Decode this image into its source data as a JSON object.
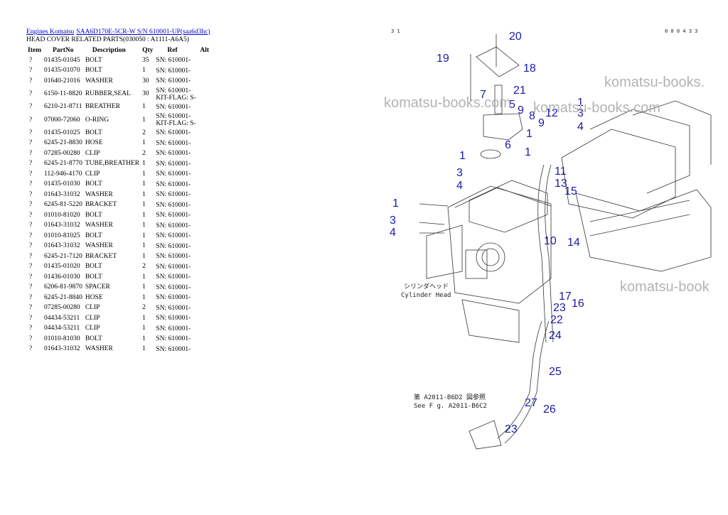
{
  "breadcrumb": [
    {
      "label": "Engines Komatsu"
    },
    {
      "label": "SAA6D170E-5CR-W S/N 610001-UP(saa6d3hc)"
    }
  ],
  "page_title": "HEAD COVER RELATED PARTS(030050 : A1111-A6A5)",
  "table": {
    "headers": [
      "Item",
      "PartNo",
      "Description",
      "Qty",
      "Ref",
      "Alt"
    ],
    "rows": [
      {
        "item": "?",
        "partno": "01435-01045",
        "desc": "BOLT",
        "qty": "35",
        "ref": "SN: 610001-"
      },
      {
        "item": "?",
        "partno": "01435-01070",
        "desc": "BOLT",
        "qty": "1",
        "ref": "SN: 610001-"
      },
      {
        "item": "?",
        "partno": "01640-21016",
        "desc": "WASHER",
        "qty": "30",
        "ref": "SN: 610001-"
      },
      {
        "item": "?",
        "partno": "6150-11-8820",
        "desc": "RUBBER,SEAL",
        "qty": "30",
        "ref": "SN: 610001- KIT-FLAG: S-"
      },
      {
        "item": "?",
        "partno": "6210-21-8711",
        "desc": "BREATHER",
        "qty": "1",
        "ref": "SN: 610001-"
      },
      {
        "item": "?",
        "partno": "07000-72060",
        "desc": "O-RING",
        "qty": "1",
        "ref": "SN: 610001- KIT-FLAG: S-"
      },
      {
        "item": "?",
        "partno": "01435-01025",
        "desc": "BOLT",
        "qty": "2",
        "ref": "SN: 610001-"
      },
      {
        "item": "?",
        "partno": "6245-21-8830",
        "desc": "HOSE",
        "qty": "1",
        "ref": "SN: 610001-"
      },
      {
        "item": "?",
        "partno": "07285-00280",
        "desc": "CLIP",
        "qty": "2",
        "ref": "SN: 610001-"
      },
      {
        "item": "?",
        "partno": "6245-21-8770",
        "desc": "TUBE,BREATHER",
        "qty": "1",
        "ref": "SN: 610001-"
      },
      {
        "item": "?",
        "partno": "112-946-4170",
        "desc": "CLIP",
        "qty": "1",
        "ref": "SN: 610001-"
      },
      {
        "item": "?",
        "partno": "01435-01030",
        "desc": "BOLT",
        "qty": "1",
        "ref": "SN: 610001-"
      },
      {
        "item": "?",
        "partno": "01643-31032",
        "desc": "WASHER",
        "qty": "1",
        "ref": "SN: 610001-"
      },
      {
        "item": "?",
        "partno": "6245-81-5220",
        "desc": "BRACKET",
        "qty": "1",
        "ref": "SN: 610001-"
      },
      {
        "item": "?",
        "partno": "01010-81020",
        "desc": "BOLT",
        "qty": "1",
        "ref": "SN: 610001-"
      },
      {
        "item": "?",
        "partno": "01643-31032",
        "desc": "WASHER",
        "qty": "1",
        "ref": "SN: 610001-"
      },
      {
        "item": "?",
        "partno": "01010-81025",
        "desc": "BOLT",
        "qty": "1",
        "ref": "SN: 610001-"
      },
      {
        "item": "?",
        "partno": "01643-31032",
        "desc": "WASHER",
        "qty": "1",
        "ref": "SN: 610001-"
      },
      {
        "item": "?",
        "partno": "6245-21-7120",
        "desc": "BRACKET",
        "qty": "1",
        "ref": "SN: 610001-"
      },
      {
        "item": "?",
        "partno": "01435-01020",
        "desc": "BOLT",
        "qty": "2",
        "ref": "SN: 610001-"
      },
      {
        "item": "?",
        "partno": "01436-01030",
        "desc": "BOLT",
        "qty": "1",
        "ref": "SN: 610001-"
      },
      {
        "item": "?",
        "partno": "6206-81-9870",
        "desc": "SPACER",
        "qty": "1",
        "ref": "SN: 610001-"
      },
      {
        "item": "?",
        "partno": "6245-21-8840",
        "desc": "HOSE",
        "qty": "1",
        "ref": "SN: 610001-"
      },
      {
        "item": "?",
        "partno": "07285-00280",
        "desc": "CLIP",
        "qty": "2",
        "ref": "SN: 610001-"
      },
      {
        "item": "?",
        "partno": "04434-53211",
        "desc": "CLIP",
        "qty": "1",
        "ref": "SN: 610001-"
      },
      {
        "item": "?",
        "partno": "04434-53211",
        "desc": "CLIP",
        "qty": "1",
        "ref": "SN: 610001-"
      },
      {
        "item": "?",
        "partno": "01010-81030",
        "desc": "BOLT",
        "qty": "1",
        "ref": "SN: 610001-"
      },
      {
        "item": "?",
        "partno": "01643-31032",
        "desc": "WASHER",
        "qty": "1",
        "ref": "SN: 610001-"
      }
    ]
  },
  "diagram": {
    "header_left": "3 1",
    "header_right": "0 0 0 4 3 3",
    "label_jp": "シリンダヘッド",
    "label_en": "Cylinder Head",
    "note_jp": "第 A2011-B6D2 図参照",
    "note_en": "See F g. A2011-B6C2",
    "callouts": [
      "20",
      "19",
      "18",
      "21",
      "7",
      "5",
      "9",
      "8",
      "12",
      "1",
      "3",
      "4",
      "6",
      "1",
      "9",
      "1",
      "11",
      "13",
      "15",
      "14",
      "3",
      "4",
      "1",
      "1",
      "3",
      "4",
      "10",
      "17",
      "16",
      "23",
      "22",
      "24",
      "25",
      "27",
      "26",
      "23"
    ],
    "watermarks": [
      "komatsu-books.",
      "komatsu-books.com",
      "komatsu-books.com",
      "komatsu-book"
    ]
  }
}
